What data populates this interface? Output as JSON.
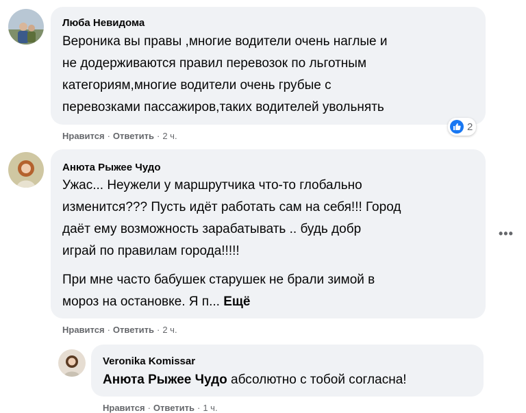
{
  "comments": [
    {
      "author": "Люба Невидома",
      "lines": [
        "Вероника вы правы ,многие водители очень наглые и",
        "не додерживаются правил перевозок по льготным",
        "категориям,многие водители очень грубые с",
        "перевозками пассажиров,таких водителей увольнять"
      ],
      "like_label": "Нравится",
      "reply_label": "Ответить",
      "time": "2 ч.",
      "reaction_count": "2"
    },
    {
      "author": "Анюта Рыжее Чудо",
      "lines": [
        "Ужас... Неужели у маршрутчика что-то глобально",
        "изменится??? Пусть идёт работать сам на себя!!! Город",
        "даёт ему возможность зарабатывать .. будь добр",
        "играй по правилам города!!!!!"
      ],
      "lines2_1": "При мне часто бабушек старушек не брали зимой в",
      "lines2_2": "мороз на остановке. Я п... ",
      "see_more": "Ещё",
      "like_label": "Нравится",
      "reply_label": "Ответить",
      "time": "2 ч."
    },
    {
      "author": "Veronika Komissar",
      "mention": "Анюта Рыжее Чудо",
      "text": " абсолютно с тобой согласна!",
      "like_label": "Нравится",
      "reply_label": "Ответить",
      "time": "1 ч."
    }
  ],
  "colors": {
    "bubble": "#f0f2f5",
    "meta": "#65676b",
    "like_blue": "#1877f2"
  },
  "icons": [
    "more-options-icon",
    "like-reaction-icon"
  ]
}
